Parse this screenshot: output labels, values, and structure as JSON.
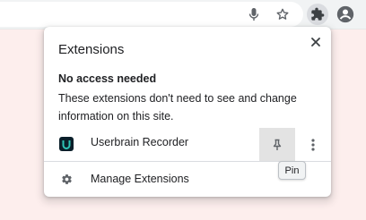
{
  "popup": {
    "title": "Extensions",
    "close_icon": "close-icon",
    "section_heading": "No access needed",
    "section_description": "These extensions don't need to see and change information on this site.",
    "extensions": [
      {
        "name": "Userbrain Recorder",
        "logo_icon": "userbrain-logo-icon",
        "pin_icon": "pin-icon",
        "more_icon": "more-vertical-icon"
      }
    ],
    "manage_label": "Manage Extensions",
    "manage_icon": "gear-icon"
  },
  "tooltip": {
    "text": "Pin"
  },
  "toolbar": {
    "icons": [
      "microphone-icon",
      "star-icon",
      "puzzle-icon",
      "profile-icon"
    ]
  },
  "colors": {
    "page_background": "#fdeeed",
    "toolbar_background": "#f1f3f4",
    "pin_button_hover": "#e3e3e3",
    "logo_background": "#0b1f2a",
    "logo_accent": "#2ec4b6"
  }
}
